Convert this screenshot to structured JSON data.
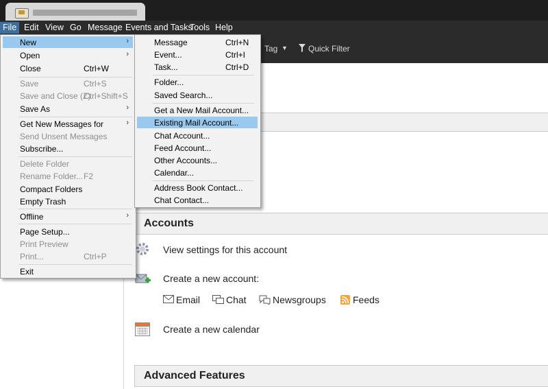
{
  "menubar": {
    "items": [
      "File",
      "Edit",
      "View",
      "Go",
      "Message",
      "Events and Tasks",
      "Tools",
      "Help"
    ]
  },
  "toolbar": {
    "tag_label": "Tag",
    "quick_filter_label": "Quick Filter"
  },
  "file_menu": {
    "items": [
      {
        "label": "New",
        "shortcut": "",
        "submenu": true,
        "disabled": false
      },
      {
        "label": "Open",
        "shortcut": "",
        "submenu": true,
        "disabled": false
      },
      {
        "label": "Close",
        "shortcut": "Ctrl+W",
        "submenu": false,
        "disabled": false
      },
      {
        "label": "Save",
        "shortcut": "Ctrl+S",
        "submenu": false,
        "disabled": true
      },
      {
        "label": "Save and Close (Z)",
        "shortcut": "Ctrl+Shift+S",
        "submenu": false,
        "disabled": true
      },
      {
        "label": "Save As",
        "shortcut": "",
        "submenu": true,
        "disabled": false
      },
      {
        "label": "Get New Messages for",
        "shortcut": "",
        "submenu": true,
        "disabled": false
      },
      {
        "label": "Send Unsent Messages",
        "shortcut": "",
        "submenu": false,
        "disabled": true
      },
      {
        "label": "Subscribe...",
        "shortcut": "",
        "submenu": false,
        "disabled": false
      },
      {
        "label": "Delete Folder",
        "shortcut": "",
        "submenu": false,
        "disabled": true
      },
      {
        "label": "Rename Folder...",
        "shortcut": "F2",
        "submenu": false,
        "disabled": true
      },
      {
        "label": "Compact Folders",
        "shortcut": "",
        "submenu": false,
        "disabled": false
      },
      {
        "label": "Empty Trash",
        "shortcut": "",
        "submenu": false,
        "disabled": false
      },
      {
        "label": "Offline",
        "shortcut": "",
        "submenu": true,
        "disabled": false
      },
      {
        "label": "Page Setup...",
        "shortcut": "",
        "submenu": false,
        "disabled": false
      },
      {
        "label": "Print Preview",
        "shortcut": "",
        "submenu": false,
        "disabled": true
      },
      {
        "label": "Print...",
        "shortcut": "Ctrl+P",
        "submenu": false,
        "disabled": true
      },
      {
        "label": "Exit",
        "shortcut": "",
        "submenu": false,
        "disabled": false
      }
    ]
  },
  "new_menu": {
    "items": [
      {
        "label": "Message",
        "shortcut": "Ctrl+N"
      },
      {
        "label": "Event...",
        "shortcut": "Ctrl+I"
      },
      {
        "label": "Task...",
        "shortcut": "Ctrl+D"
      },
      {
        "label": "Folder...",
        "shortcut": ""
      },
      {
        "label": "Saved Search...",
        "shortcut": ""
      },
      {
        "label": "Get a New Mail Account...",
        "shortcut": ""
      },
      {
        "label": "Existing Mail Account...",
        "shortcut": ""
      },
      {
        "label": "Chat Account...",
        "shortcut": ""
      },
      {
        "label": "Feed Account...",
        "shortcut": ""
      },
      {
        "label": "Other Accounts...",
        "shortcut": ""
      },
      {
        "label": "Calendar...",
        "shortcut": ""
      },
      {
        "label": "Address Book Contact...",
        "shortcut": ""
      },
      {
        "label": "Chat Contact...",
        "shortcut": ""
      }
    ]
  },
  "main": {
    "accounts_heading": "Accounts",
    "view_settings": "View settings for this account",
    "create_account": "Create a new account:",
    "links": [
      "Email",
      "Chat",
      "Newsgroups",
      "Feeds"
    ],
    "create_calendar": "Create a new calendar",
    "advanced_heading": "Advanced Features"
  },
  "colors": {
    "menubar_bg": "#2b2b2b",
    "menu_highlight": "#99c9ef",
    "file_active": "#3d6e9c"
  }
}
